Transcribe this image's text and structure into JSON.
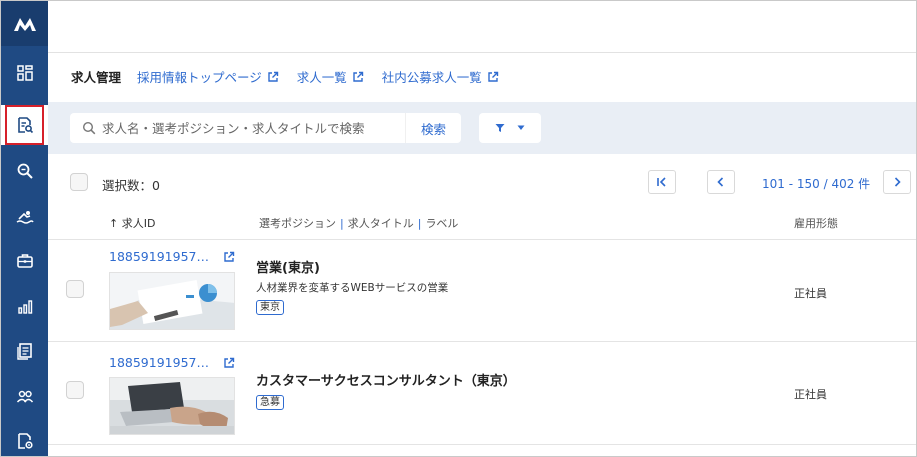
{
  "app": {
    "logo_icon": "brand-logo-icon",
    "accent_color": "#2f6bcf",
    "sidebar_color": "#1f4a83"
  },
  "sidebar": {
    "items": [
      {
        "icon": "dashboard-grid-icon"
      },
      {
        "icon": "job-document-search-icon",
        "active": true
      },
      {
        "icon": "magnify-search-icon"
      },
      {
        "icon": "swimmer-icon"
      },
      {
        "icon": "briefcase-icon"
      },
      {
        "icon": "bar-chart-icon"
      },
      {
        "icon": "document-list-icon"
      },
      {
        "icon": "people-group-icon"
      },
      {
        "icon": "document-settings-icon"
      }
    ]
  },
  "breadcrumb": {
    "title": "求人管理",
    "links": [
      {
        "label": "採用情報トップページ"
      },
      {
        "label": "求人一覧"
      },
      {
        "label": "社内公募求人一覧"
      }
    ]
  },
  "search": {
    "placeholder": "求人名・選考ポジション・求人タイトルで検索",
    "button_label": "検索"
  },
  "selection": {
    "label": "選択数：0"
  },
  "pagination": {
    "range_text": "101 - 150 / 402 件",
    "first_label": "I<",
    "prev_label": "<",
    "next_label": ">"
  },
  "table": {
    "headers": {
      "id": "↑ 求人ID",
      "position": "選考ポジション",
      "title": "求人タイトル",
      "label": "ラベル",
      "employment": "雇用形態"
    },
    "rows": [
      {
        "id": "18859191957…",
        "title": "営業(東京)",
        "description": "人材業界を変革するWEBサービスの営業",
        "tag": "東京",
        "employment": "正社員"
      },
      {
        "id": "18859191957…",
        "title": "カスタマーサクセスコンサルタント（東京）",
        "description": "",
        "tag": "急募",
        "employment": "正社員"
      }
    ]
  }
}
